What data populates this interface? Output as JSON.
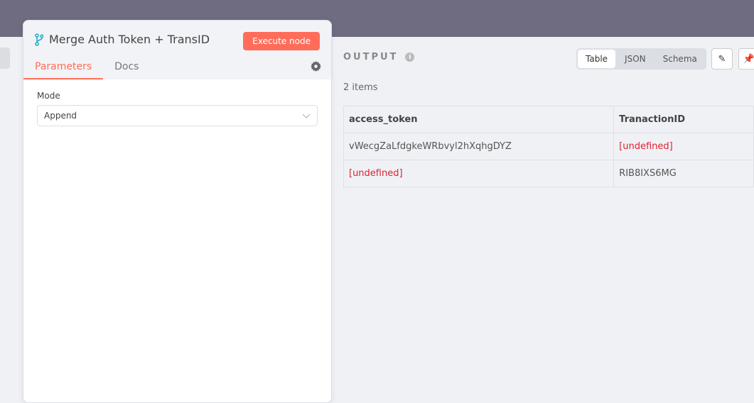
{
  "node": {
    "title": "Merge Auth Token + TransID",
    "execute_label": "Execute node",
    "tabs": [
      "Parameters",
      "Docs"
    ],
    "mode_label": "Mode",
    "mode_value": "Append"
  },
  "output": {
    "label": "OUTPUT",
    "views": [
      "Table",
      "JSON",
      "Schema"
    ],
    "count": "2 items",
    "columns": [
      "access_token",
      "TranactionID"
    ],
    "rows": [
      [
        "vWecgZaLfdgkeWRbvyl2hXqhgDYZ",
        "[undefined]"
      ],
      [
        "[undefined]",
        "RIB8IXS6MG"
      ]
    ]
  },
  "colors": {
    "accent": "#ff6d5a",
    "undefined": "#e0212f",
    "topbar": "#6f6b80"
  }
}
